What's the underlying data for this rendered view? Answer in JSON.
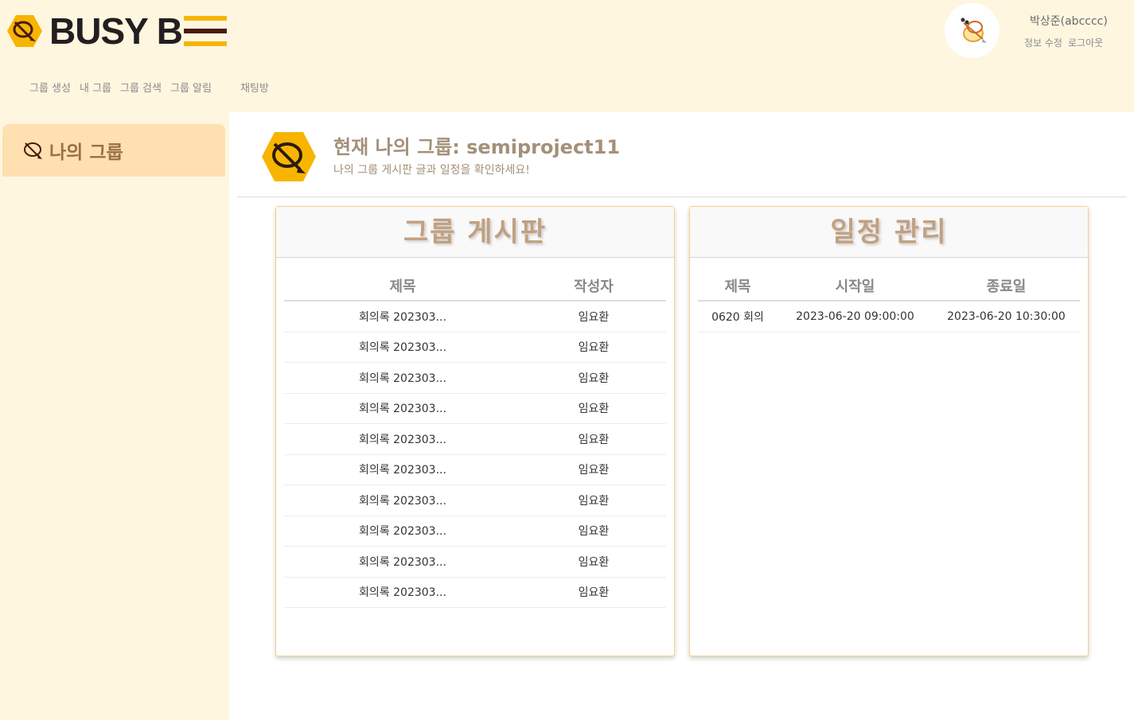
{
  "header": {
    "logo_text": "BUSY B",
    "nav": [
      "그룹 생성",
      "내 그룹",
      "그룹 검색",
      "그룹 알림",
      "채팅방"
    ],
    "user_name": "박상준(abcccc)",
    "user_links": [
      "정보 수정",
      "로그아웃"
    ]
  },
  "sidebar": {
    "item_label": "나의 그룹"
  },
  "main": {
    "title": "현재 나의 그룹: semiproject11",
    "subtitle": "나의 그룹 게시판 글과 일정을 확인하세요!"
  },
  "board": {
    "title": "그룹 게시판",
    "columns": [
      "제목",
      "작성자"
    ],
    "rows": [
      {
        "title": "회의록 202303...",
        "author": "임요환"
      },
      {
        "title": "회의록 202303...",
        "author": "임요환"
      },
      {
        "title": "회의록 202303...",
        "author": "임요환"
      },
      {
        "title": "회의록 202303...",
        "author": "임요환"
      },
      {
        "title": "회의록 202303...",
        "author": "임요환"
      },
      {
        "title": "회의록 202303...",
        "author": "임요환"
      },
      {
        "title": "회의록 202303...",
        "author": "임요환"
      },
      {
        "title": "회의록 202303...",
        "author": "임요환"
      },
      {
        "title": "회의록 202303...",
        "author": "임요환"
      },
      {
        "title": "회의록 202303...",
        "author": "임요환"
      }
    ]
  },
  "schedule": {
    "title": "일정 관리",
    "columns": [
      "제목",
      "시작일",
      "종료일"
    ],
    "rows": [
      {
        "title": "0620 회의",
        "start": "2023-06-20 09:00:00",
        "end": "2023-06-20 10:30:00"
      }
    ]
  },
  "colors": {
    "header_bg": "#fff6e0",
    "accent_yellow": "#f7b500",
    "logo_bar_dark": "#4a1a10",
    "sidebar_active": "#ffe0b0",
    "title_brown": "#a39079",
    "panel_border": "#f2d387"
  }
}
